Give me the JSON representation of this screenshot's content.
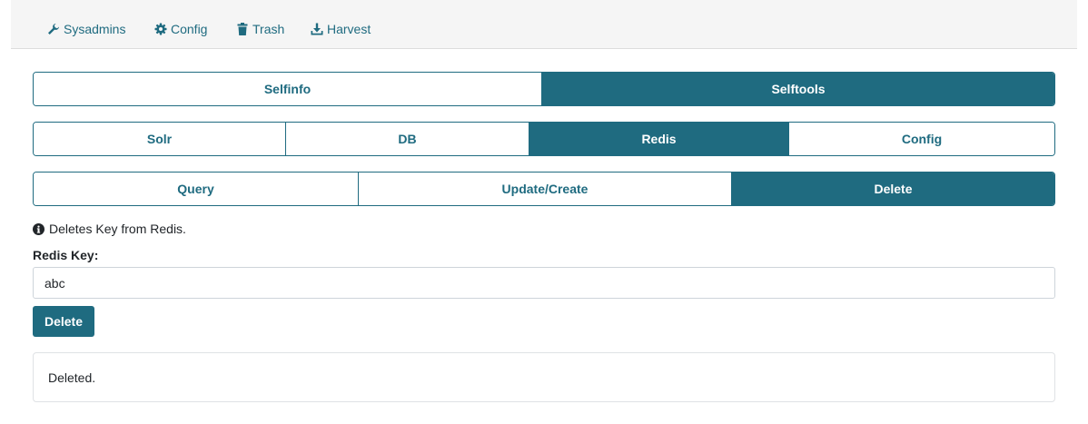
{
  "topnav": {
    "items": [
      {
        "label": "Sysadmins",
        "icon": "wrench-icon"
      },
      {
        "label": "Config",
        "icon": "gear-icon"
      },
      {
        "label": "Trash",
        "icon": "trash-icon"
      },
      {
        "label": "Harvest",
        "icon": "download-icon"
      }
    ]
  },
  "level1": {
    "tabs": [
      {
        "label": "Selfinfo",
        "active": false
      },
      {
        "label": "Selftools",
        "active": true
      }
    ]
  },
  "level2": {
    "tabs": [
      {
        "label": "Solr",
        "active": false
      },
      {
        "label": "DB",
        "active": false
      },
      {
        "label": "Redis",
        "active": true
      },
      {
        "label": "Config",
        "active": false
      }
    ]
  },
  "level3": {
    "tabs": [
      {
        "label": "Query",
        "active": false
      },
      {
        "label": "Update/Create",
        "active": false
      },
      {
        "label": "Delete",
        "active": true
      }
    ]
  },
  "form": {
    "info_text": "Deletes Key from Redis.",
    "key_label": "Redis Key:",
    "key_value": "abc",
    "submit_label": "Delete"
  },
  "result": {
    "message": "Deleted."
  },
  "colors": {
    "accent": "#1f6b80",
    "nav_background": "#f5f5f5"
  }
}
